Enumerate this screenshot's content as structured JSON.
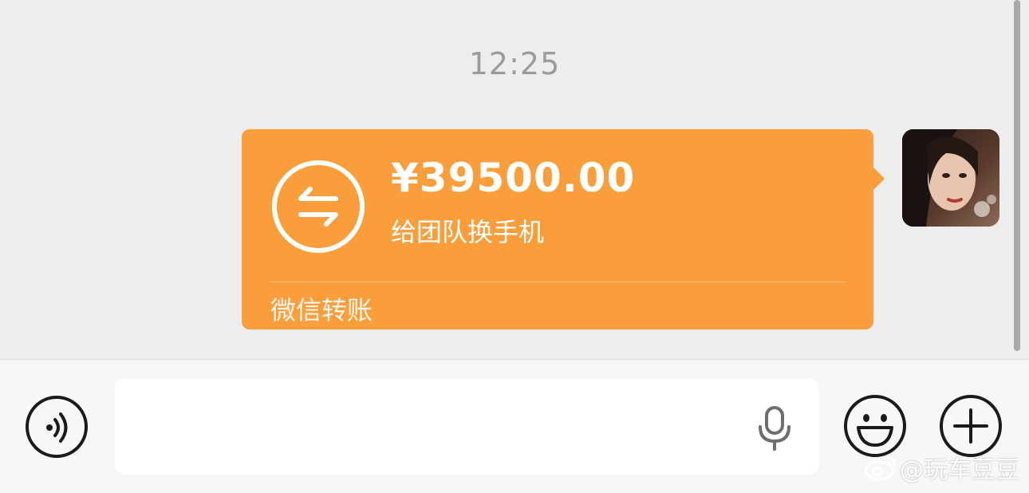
{
  "chat": {
    "timestamp": "12:25"
  },
  "transfer": {
    "amount": "¥39500.00",
    "note": "给团队换手机",
    "service_label": "微信转账",
    "icon": "transfer-arrows-icon",
    "color": "#f99e3a"
  },
  "avatar": {
    "icon": "user-avatar"
  },
  "input_bar": {
    "text_value": "",
    "placeholder": "",
    "voice_icon": "voice-mode-icon",
    "mic_icon": "microphone-icon",
    "emoji_icon": "emoji-icon",
    "plus_icon": "plus-icon"
  },
  "watermark": {
    "text": "@玩车豆豆"
  }
}
